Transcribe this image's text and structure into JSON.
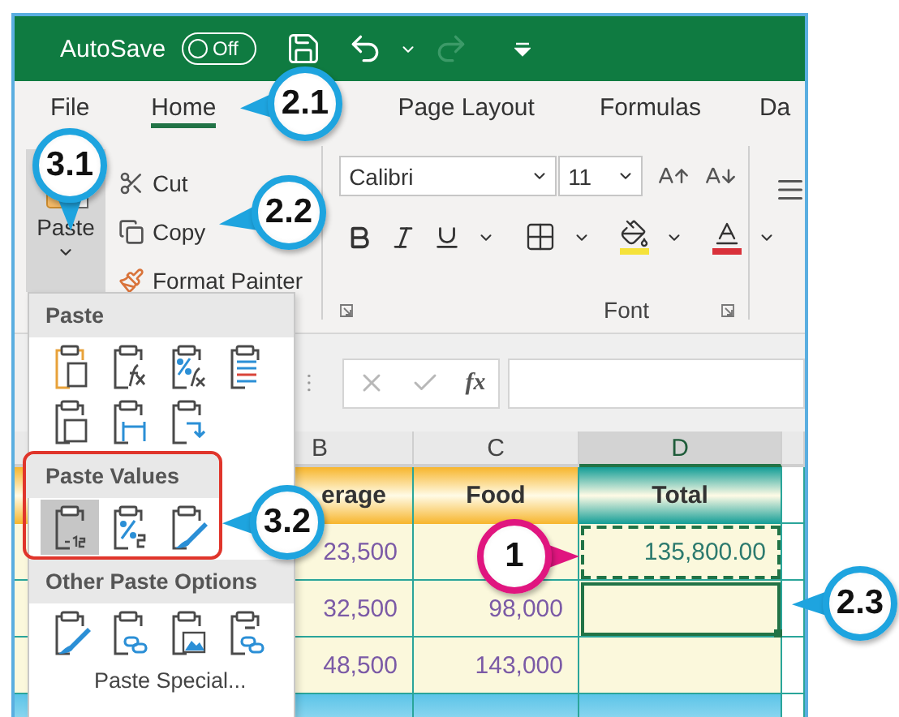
{
  "title_bar": {
    "autosave_label": "AutoSave",
    "autosave_toggle": {
      "label": "Off",
      "on": false
    },
    "redo_disabled": true
  },
  "ribbon_tabs": [
    {
      "label": "File",
      "selected": false
    },
    {
      "label": "Home",
      "selected": true
    },
    {
      "label": "Page Layout",
      "selected": false
    },
    {
      "label": "Formulas",
      "selected": false
    },
    {
      "label": "Da",
      "selected": false
    }
  ],
  "clipboard": {
    "paste": {
      "label": "Paste",
      "open": true
    },
    "commands": [
      {
        "label": "Cut",
        "kind": "cut"
      },
      {
        "label": "Copy",
        "kind": "copy"
      },
      {
        "label": "Format Painter",
        "kind": "format-painter"
      }
    ]
  },
  "font_group": {
    "font_name": "Calibri",
    "font_size": "11",
    "label": "Font"
  },
  "formula_bar": {
    "function_label": "fx"
  },
  "sheet": {
    "columns": [
      {
        "label": "B",
        "selected": false
      },
      {
        "label": "C",
        "selected": false
      },
      {
        "label": "D",
        "selected": true
      }
    ],
    "header_row": [
      {
        "text": "erage",
        "color": "#f7b52c"
      },
      {
        "text": "Food",
        "color": "#f7b52c"
      },
      {
        "text": "Total",
        "color": "#129d96"
      }
    ],
    "rows": [
      {
        "b": "23,500",
        "d": "135,800.00",
        "d_copied": true,
        "d_selected": false
      },
      {
        "b": "32,500",
        "c": "98,000",
        "d_copied": false,
        "d_selected": true
      },
      {
        "b": "48,500",
        "c": "143,000",
        "d_copied": false,
        "d_selected": false
      }
    ]
  },
  "paste_menu": {
    "sections": [
      {
        "title": "Paste",
        "highlighted": false,
        "options": [
          {
            "kind": "page",
            "selected": false
          },
          {
            "kind": "fx",
            "selected": false
          },
          {
            "kind": "percent-fx",
            "selected": false
          },
          {
            "kind": "lines",
            "selected": false
          },
          {
            "kind": "grid",
            "selected": false
          },
          {
            "kind": "columns",
            "selected": false
          },
          {
            "kind": "transpose",
            "selected": false
          }
        ]
      },
      {
        "title": "Paste Values",
        "highlighted": true,
        "options": [
          {
            "kind": "values",
            "selected": true
          },
          {
            "kind": "percent",
            "selected": false
          },
          {
            "kind": "brush",
            "selected": false
          }
        ]
      },
      {
        "title": "Other Paste Options",
        "highlighted": false,
        "options": [
          {
            "kind": "brush",
            "selected": false
          },
          {
            "kind": "link",
            "selected": false
          },
          {
            "kind": "picture",
            "selected": false
          },
          {
            "kind": "link-picture",
            "selected": false
          }
        ]
      }
    ],
    "footer": "Paste Special..."
  },
  "callouts": [
    {
      "label": "2.1",
      "color": "#1ea4df"
    },
    {
      "label": "3.1",
      "color": "#1ea4df"
    },
    {
      "label": "2.2",
      "color": "#1ea4df"
    },
    {
      "label": "3.2",
      "color": "#1ea4df"
    },
    {
      "label": "1",
      "color": "#e0157f"
    },
    {
      "label": "2.3",
      "color": "#1ea4df"
    }
  ]
}
